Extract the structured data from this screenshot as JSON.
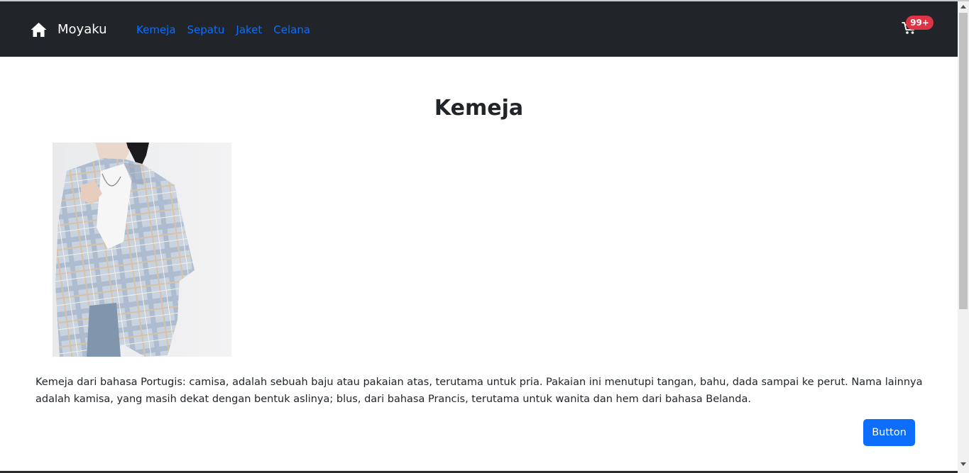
{
  "navbar": {
    "brand_icon": "home-icon",
    "brand_name": "Moyaku",
    "links": [
      {
        "label": "Kemeja"
      },
      {
        "label": "Sepatu"
      },
      {
        "label": "Jaket"
      },
      {
        "label": "Celana"
      }
    ],
    "cart_icon": "cart-icon",
    "cart_badge": "99+"
  },
  "main": {
    "title": "Kemeja",
    "description": "Kemeja dari bahasa Portugis: camisa, adalah sebuah baju atau pakaian atas, terutama untuk pria. Pakaian ini menutupi tangan, bahu, dada sampai ke perut. Nama lainnya adalah kamisa, yang masih dekat dengan bentuk aslinya; blus, dari bahasa Prancis, terutama untuk wanita dan hem dari bahasa Belanda.",
    "button_label": "Button"
  },
  "colors": {
    "navbar_bg": "#212529",
    "link": "#0d6efd",
    "badge": "#dc3545",
    "button": "#0d6efd"
  }
}
